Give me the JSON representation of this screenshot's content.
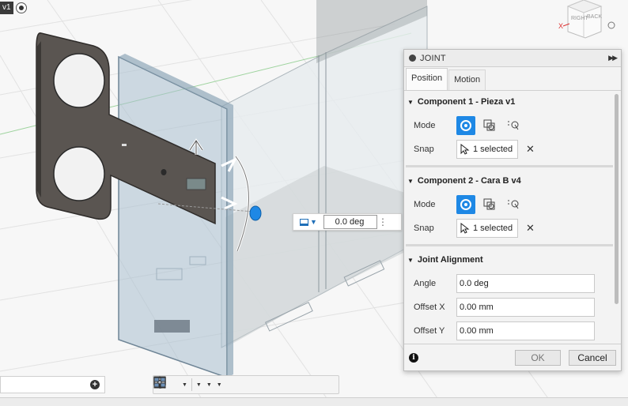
{
  "document": {
    "tag": "v1"
  },
  "canvas_value_box": {
    "value": "0.0 deg"
  },
  "joint_panel": {
    "title": "JOINT",
    "tabs": [
      {
        "label": "Position",
        "active": true
      },
      {
        "label": "Motion",
        "active": false
      }
    ],
    "component1": {
      "title": "Component 1 - Pieza v1",
      "mode_label": "Mode",
      "snap_label": "Snap",
      "snap_value": "1 selected"
    },
    "component2": {
      "title": "Component 2 - Cara B v4",
      "mode_label": "Mode",
      "snap_label": "Snap",
      "snap_value": "1 selected"
    },
    "alignment": {
      "title": "Joint Alignment",
      "angle_label": "Angle",
      "angle_value": "0.0 deg",
      "offset_x_label": "Offset X",
      "offset_x_value": "0.00 mm",
      "offset_y_label": "Offset Y",
      "offset_y_value": "0.00 mm"
    },
    "ok_label": "OK",
    "cancel_label": "Cancel"
  },
  "viewcube": {
    "face_front": "RIGHT",
    "face_side": "BACK",
    "axis_x": "X"
  },
  "colors": {
    "accent": "#1e88e5",
    "panel_bg": "#f3f3f3",
    "part_dark": "#5a5551",
    "glass": "#b9cad6"
  }
}
